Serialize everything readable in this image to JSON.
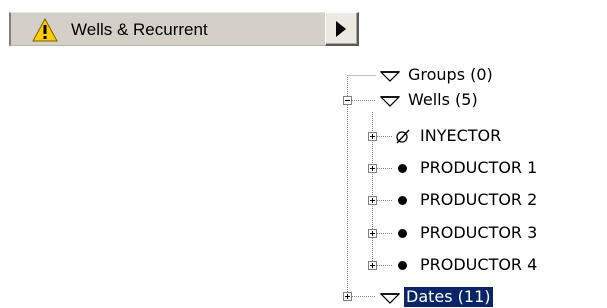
{
  "menu": {
    "item_label": "Wells & Recurrent",
    "icon": "warning-icon",
    "submenu_arrow": "triangle-right-icon"
  },
  "tree": {
    "groups": {
      "label": "Groups (0)",
      "icon": "funnel-icon"
    },
    "wells": {
      "label": "Wells (5)",
      "icon": "funnel-icon",
      "expanded": true,
      "children": [
        {
          "label": "INYECTOR",
          "icon": "injector-well-icon"
        },
        {
          "label": "PRODUCTOR 1",
          "icon": "producer-well-icon"
        },
        {
          "label": "PRODUCTOR 2",
          "icon": "producer-well-icon"
        },
        {
          "label": "PRODUCTOR 3",
          "icon": "producer-well-icon"
        },
        {
          "label": "PRODUCTOR 4",
          "icon": "producer-well-icon"
        }
      ]
    },
    "dates": {
      "label": "Dates (11)",
      "icon": "funnel-icon",
      "selected": true
    }
  },
  "colors": {
    "selection_bg": "#0a246a",
    "selection_fg": "#ffffff",
    "menu_bg": "#d4d0c8",
    "warning_yellow": "#ffcc00"
  }
}
